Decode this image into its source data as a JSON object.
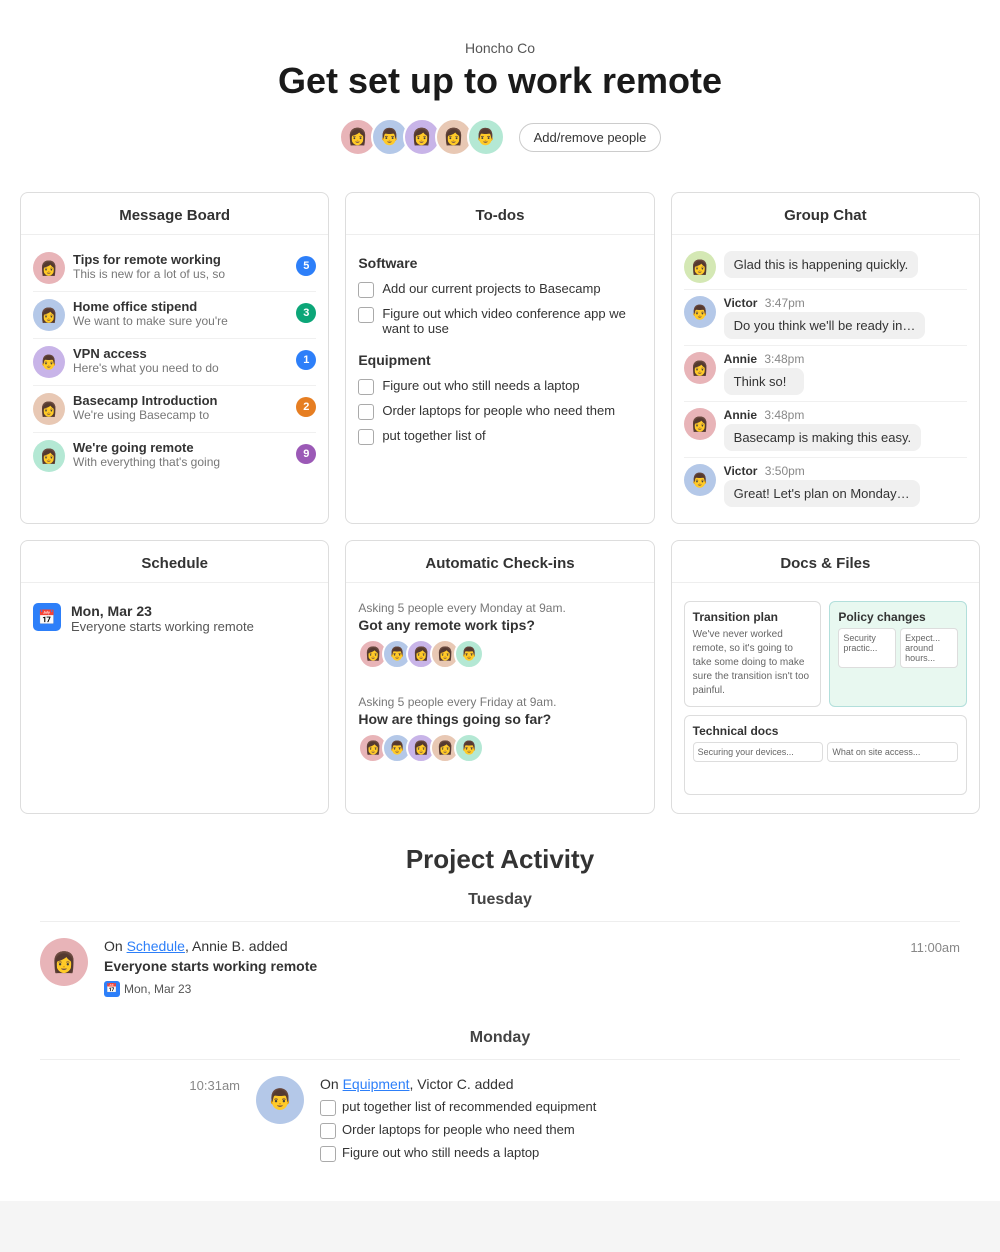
{
  "header": {
    "company": "Honcho Co",
    "title": "Get set up to work remote",
    "add_people_label": "Add/remove people"
  },
  "avatars": [
    {
      "emoji": "👩",
      "color": "#e8b4b8"
    },
    {
      "emoji": "👨",
      "color": "#b4c8e8"
    },
    {
      "emoji": "👩",
      "color": "#c8b4e8"
    },
    {
      "emoji": "👩",
      "color": "#e8c8b4"
    },
    {
      "emoji": "👨",
      "color": "#b4e8d4"
    }
  ],
  "message_board": {
    "title": "Message Board",
    "items": [
      {
        "title": "Tips for remote working",
        "preview": "This is new for a lot of us, so",
        "badge": "5",
        "badge_color": "badge-blue"
      },
      {
        "title": "Home office stipend",
        "preview": "We want to make sure you're",
        "badge": "3",
        "badge_color": "badge-teal"
      },
      {
        "title": "VPN access",
        "preview": "Here's what you need to do",
        "badge": "1",
        "badge_color": "badge-blue"
      },
      {
        "title": "Basecamp Introduction",
        "preview": "We're using Basecamp to",
        "badge": "2",
        "badge_color": "badge-orange"
      },
      {
        "title": "We're going remote",
        "preview": "With everything that's going",
        "badge": "9",
        "badge_color": "badge-purple"
      }
    ]
  },
  "todos": {
    "title": "To-dos",
    "sections": [
      {
        "name": "Software",
        "items": [
          "Add our current projects to Basecamp",
          "Figure out which video conference app we want to use"
        ]
      },
      {
        "name": "Equipment",
        "items": [
          "Figure out who still needs a laptop",
          "Order laptops for people who need them",
          "put together list of"
        ]
      }
    ]
  },
  "group_chat": {
    "title": "Group Chat",
    "messages": [
      {
        "sender": "",
        "time": "",
        "text": "Glad this is happening quickly.",
        "has_avatar": true
      },
      {
        "sender": "Victor",
        "time": "3:47pm",
        "text": "Do you think we'll be ready in…",
        "has_avatar": true
      },
      {
        "sender": "Annie",
        "time": "3:48pm",
        "text": "Think so!",
        "has_avatar": true
      },
      {
        "sender": "Annie",
        "time": "3:48pm",
        "text": "Basecamp is making this easy.",
        "has_avatar": true
      },
      {
        "sender": "Victor",
        "time": "3:50pm",
        "text": "Great! Let's plan on Monday…",
        "has_avatar": true
      }
    ]
  },
  "schedule": {
    "title": "Schedule",
    "items": [
      {
        "date": "Mon, Mar 23",
        "description": "Everyone starts working remote"
      }
    ]
  },
  "checkins": {
    "title": "Automatic Check-ins",
    "items": [
      {
        "asking": "Asking 5 people every Monday at 9am.",
        "question": "Got any remote work tips?"
      },
      {
        "asking": "Asking 5 people every Friday at 9am.",
        "question": "How are things going so far?"
      }
    ]
  },
  "docs": {
    "title": "Docs & Files",
    "items": [
      {
        "title": "Transition plan",
        "text": "We've never worked remote, so it's going to take some doing to make sure the transition isn't too painful.",
        "style": "white"
      },
      {
        "title": "Policy changes",
        "text": "Security practic... Expect... around hours...",
        "style": "green"
      },
      {
        "title": "Technical docs",
        "text": "Securing your devices... What on site access...",
        "style": "white",
        "wide": true
      }
    ]
  },
  "activity": {
    "title": "Project Activity",
    "days": [
      {
        "label": "Tuesday",
        "events": [
          {
            "time": "11:00am",
            "actor": "Annie B.",
            "action_prefix": "On",
            "link_text": "Schedule",
            "action_suffix": ", Annie B. added",
            "event_title": "Everyone starts working remote",
            "sub": "Mon, Mar 23",
            "side": "left"
          }
        ]
      },
      {
        "label": "Monday",
        "events": [
          {
            "time": "10:31am",
            "actor": "Victor C.",
            "action_prefix": "On",
            "link_text": "Equipment",
            "action_suffix": ", Victor C. added",
            "side": "right",
            "todo_items": [
              "put together list of recommended equipment",
              "Order laptops for people who need them",
              "Figure out who still needs a laptop"
            ]
          }
        ]
      }
    ]
  }
}
